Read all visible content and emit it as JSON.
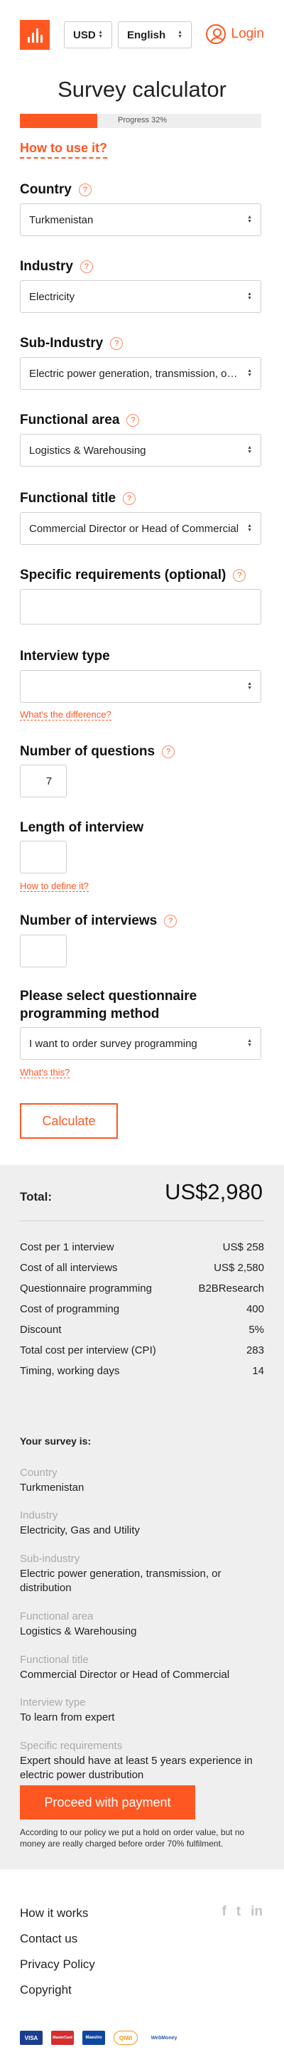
{
  "header": {
    "currency": "USD",
    "language": "English",
    "login_label": "Login",
    "accent": "#ff5722"
  },
  "page_title": "Survey calculator",
  "progress": {
    "label": "Progress 32%",
    "value": 0.32
  },
  "how_to_use": "How to use it?",
  "form": {
    "country": {
      "label": "Country",
      "value": "Turkmenistan",
      "help": "?"
    },
    "industry": {
      "label": "Industry",
      "value": "Electricity",
      "help": "?"
    },
    "sub_industry": {
      "label": "Sub-Industry",
      "value": "Electric power generation, transmission, or distribution",
      "help": "?"
    },
    "functional_area": {
      "label": "Functional area",
      "value": "Logistics & Warehousing",
      "help": "?"
    },
    "functional_title": {
      "label": "Functional title",
      "value": "Commercial Director or Head of Commercial",
      "help": "?"
    },
    "specific_requirements": {
      "label": "Specific requirements (optional)",
      "value": "",
      "help": "?"
    },
    "interview_type": {
      "label": "Interview type",
      "value": "",
      "link": "What's the difference?"
    },
    "number_of_questions": {
      "label": "Number of questions",
      "value": "7",
      "help": "?"
    },
    "length_of_interview": {
      "label": "Length of interview",
      "value": "",
      "link": "How to define it?"
    },
    "number_of_interviews": {
      "label": "Number of interviews",
      "value": "",
      "help": "?"
    },
    "programming": {
      "label_line1": "Please select questionnaire",
      "label_line2": "programming method",
      "value": "I want to order survey programming",
      "link": "What's this?"
    },
    "calculate_label": "Calculate"
  },
  "summary": {
    "total_label": "Total:",
    "total_value": "US$2,980",
    "rows": [
      {
        "label": "Cost per 1 interview",
        "value": "US$ 258"
      },
      {
        "label": "Cost of all interviews",
        "value": "US$ 2,580"
      },
      {
        "label": "Questionnaire programming",
        "value": "B2BResearch"
      },
      {
        "label": "Cost of programming",
        "value": "400"
      },
      {
        "label": "Discount",
        "value": "5%"
      },
      {
        "label": "Total cost per interview (CPI)",
        "value": "283"
      },
      {
        "label": "Timing, working days",
        "value": "14"
      }
    ],
    "your_survey_label": "Your survey is:",
    "details": [
      {
        "key": "Country",
        "value": "Turkmenistan"
      },
      {
        "key": "Industry",
        "value": "Electricity, Gas and Utility"
      },
      {
        "key": "Sub-industry",
        "value": "Electric power generation, transmission, or distribution"
      },
      {
        "key": "Functional area",
        "value": "Logistics & Warehousing"
      },
      {
        "key": "Functional title",
        "value": "Commercial Director or Head of Commercial"
      },
      {
        "key": "Interview type",
        "value": "To learn from expert"
      },
      {
        "key": "Specific requirements",
        "value": "Expert should have at least 5 years experience in electric power dustribution"
      }
    ],
    "proceed_label": "Proceed with payment",
    "note": "According to our policy we put a hold on order value, but no money are really charged before order 70% fulfilment."
  },
  "footer": {
    "links": [
      "How it works",
      "Contact us",
      "Privacy Policy",
      "Copyright"
    ],
    "social": {
      "facebook": "f",
      "twitter": "t",
      "linkedin": "in"
    },
    "payments": [
      "VISA",
      "MasterCard",
      "Maestro",
      "QIWI",
      "WebMoney"
    ]
  }
}
